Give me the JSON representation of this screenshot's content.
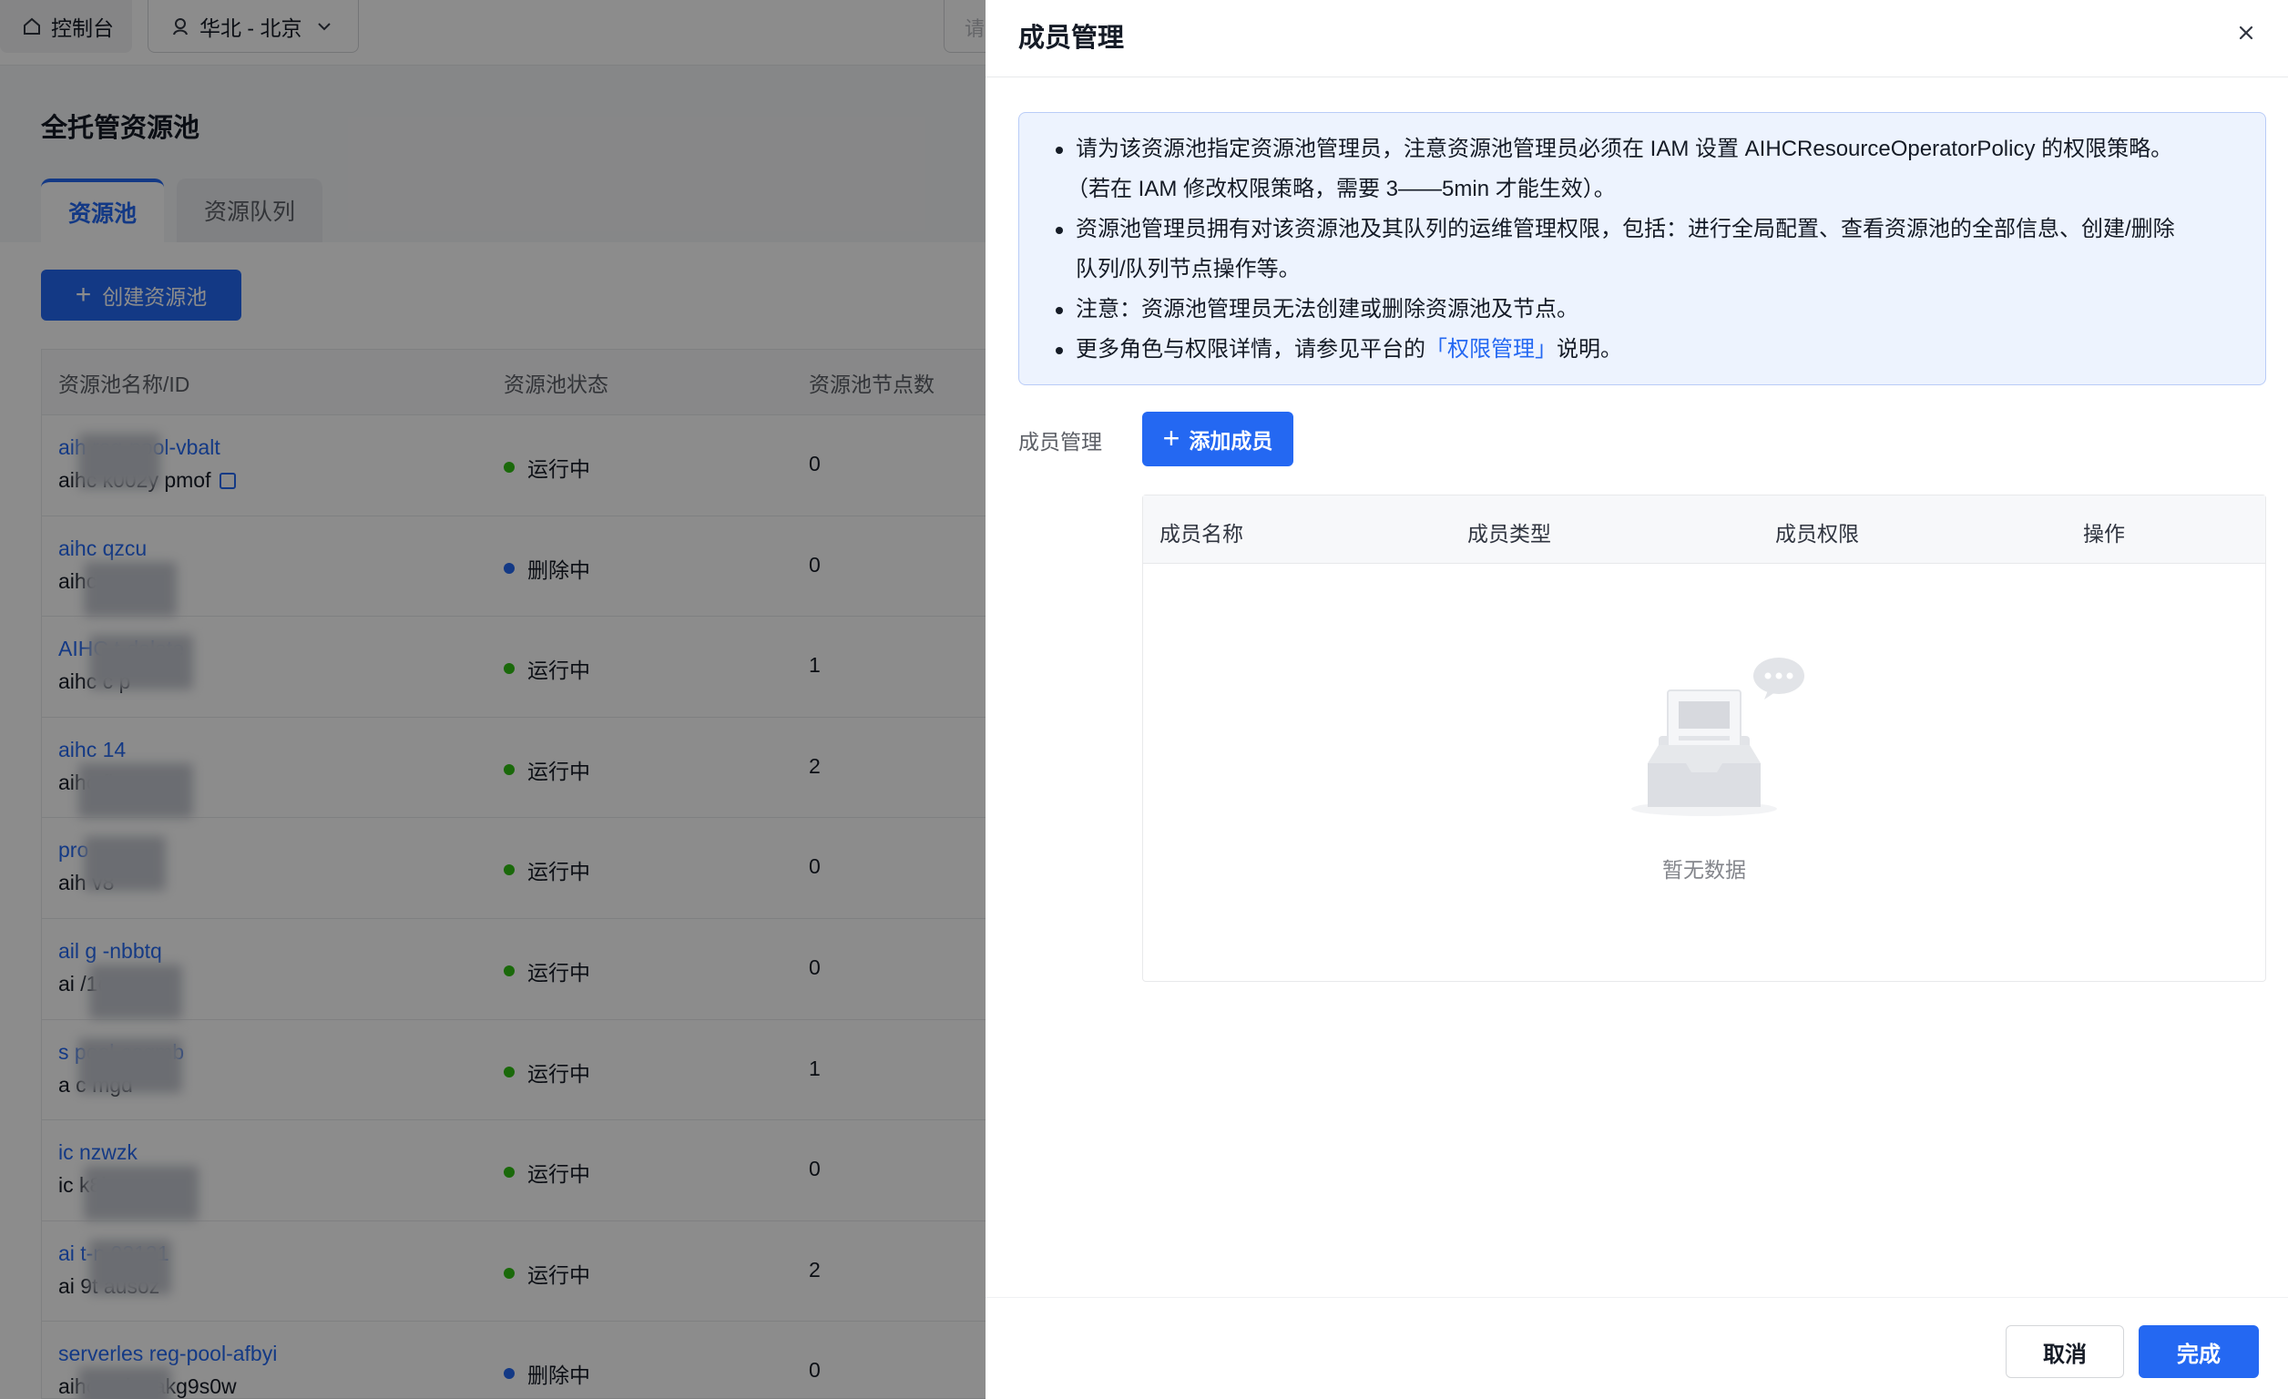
{
  "topbar": {
    "home_label": "控制台",
    "region_label": "华北 - 北京",
    "search_stub": "请"
  },
  "page": {
    "title": "全托管资源池",
    "tabs": [
      {
        "label": "资源池",
        "active": true
      },
      {
        "label": "资源队列",
        "active": false
      }
    ],
    "create_button": "创建资源池"
  },
  "table": {
    "headers": [
      "资源池名称/ID",
      "资源池状态",
      "资源池节点数"
    ],
    "rows": [
      {
        "name": "aih reg-pool-vbalt",
        "id": "aihc k002y pmof",
        "status": "运行中",
        "status_color": "#30bf13",
        "nodes": "0"
      },
      {
        "name": "aihc qzcu",
        "id": "aihc pzy",
        "status": "删除中",
        "status_color": "#2468f2",
        "nodes": "0"
      },
      {
        "name": "AIHC t-delete",
        "id": "aihc c p",
        "status": "运行中",
        "status_color": "#30bf13",
        "nodes": "1"
      },
      {
        "name": "aihc 14",
        "id": "aihc fj a",
        "status": "运行中",
        "status_color": "#30bf13",
        "nodes": "2"
      },
      {
        "name": "pro",
        "id": "aih v8",
        "status": "运行中",
        "status_color": "#30bf13",
        "nodes": "0"
      },
      {
        "name": "ail g -nbbtq",
        "id": "ai /1c",
        "status": "运行中",
        "status_color": "#30bf13",
        "nodes": "0"
      },
      {
        "name": "s pool-cogmb",
        "id": "a c mgd",
        "status": "运行中",
        "status_color": "#30bf13",
        "nodes": "1"
      },
      {
        "name": "ic nzwzk",
        "id": "ic k8h",
        "status": "运行中",
        "status_color": "#30bf13",
        "nodes": "0"
      },
      {
        "name": "ai t-n 02121",
        "id": "ai 9t ausoz",
        "status": "运行中",
        "status_color": "#30bf13",
        "nodes": "2"
      },
      {
        "name": "serverles reg-pool-afbyi",
        "id": "aihc-vaiaaakg9s0w",
        "status": "删除中",
        "status_color": "#2468f2",
        "nodes": "0"
      }
    ]
  },
  "drawer": {
    "title": "成员管理",
    "notice": {
      "line1": "请为该资源池指定资源池管理员，注意资源池管理员必须在 IAM 设置 AIHCResourceOperatorPolicy 的权限策略。",
      "line1b": "（若在 IAM 修改权限策略，需要 3——5min 才能生效）。",
      "line2": "资源池管理员拥有对该资源池及其队列的运维管理权限，包括：进行全局配置、查看资源池的全部信息、创建/删除",
      "line2b": "队列/队列节点操作等。",
      "line3": "注意：资源池管理员无法创建或删除资源池及节点。",
      "line4_pre": "更多角色与权限详情，请参见平台的",
      "line4_link": "「权限管理」",
      "line4_post": "说明。"
    },
    "member_label": "成员管理",
    "add_button": "添加成员",
    "columns": [
      "成员名称",
      "成员类型",
      "成员权限",
      "操作"
    ],
    "empty_text": "暂无数据",
    "cancel_button": "取消",
    "done_button": "完成"
  },
  "colors": {
    "primary": "#2468f2",
    "running": "#30bf13",
    "deleting": "#2468f2"
  }
}
